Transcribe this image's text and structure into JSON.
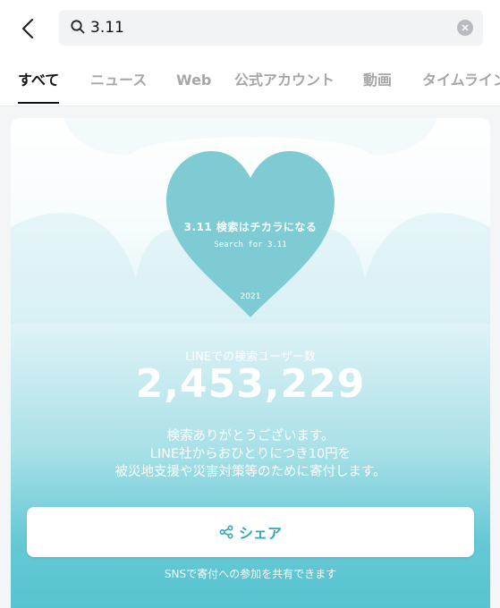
{
  "search": {
    "value": "3.11"
  },
  "tabs": [
    {
      "label": "すべて",
      "active": true
    },
    {
      "label": "ニュース",
      "active": false
    },
    {
      "label": "Web",
      "active": false
    },
    {
      "label": "公式アカウント",
      "active": false
    },
    {
      "label": "動画",
      "active": false
    },
    {
      "label": "タイムライン",
      "active": false
    }
  ],
  "card": {
    "heart_title": "3.11 検索はチカラになる",
    "heart_subtitle": "Search for 3.11",
    "heart_year": "2021",
    "count_label": "LINEでの検索ユーザー数",
    "count_value": "2,453,229",
    "thanks_lines": [
      "検索ありがとうございます。",
      "LINE社からおひとりにつき10円を",
      "被災地支援や災害対策等のために寄付します。"
    ],
    "share_label": "シェア",
    "share_note": "SNSで寄付への参加を共有できます"
  },
  "colors": {
    "heart": "#7fcbd3",
    "accent": "#2fa9bb",
    "gradient_bottom": "#58c3d0"
  },
  "icons": {
    "back": "chevron-left-icon",
    "search": "search-icon",
    "clear": "clear-icon",
    "share": "share-icon"
  }
}
